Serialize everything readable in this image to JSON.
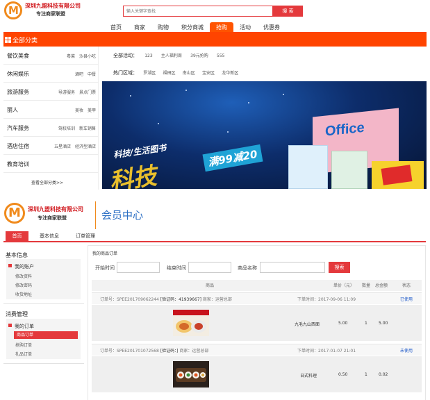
{
  "header": {
    "company_name": "深圳九盟科技有限公司",
    "slogan": "专注商家联盟",
    "search_placeholder": "输入关键字查找",
    "search_button": "搜 索",
    "nav": [
      "首页",
      "商家",
      "购物",
      "积分商城",
      "抢购",
      "活动",
      "优惠券"
    ],
    "nav_active": "抢购",
    "all_categories": "全部分类"
  },
  "categories": [
    {
      "name": "餐饮美食",
      "subs": [
        "粤菜",
        "沙县小吃"
      ]
    },
    {
      "name": "休闲娱乐",
      "subs": [
        "酒吧",
        "中餐"
      ]
    },
    {
      "name": "旅游服务",
      "subs": [
        "导游服务",
        "景点门票"
      ]
    },
    {
      "name": "丽人",
      "subs": [
        "美妆",
        "美甲"
      ]
    },
    {
      "name": "汽车服务",
      "subs": [
        "驾校培训",
        "新车销售"
      ]
    },
    {
      "name": "酒店住宿",
      "subs": [
        "五星酒店",
        "经济型酒店"
      ]
    },
    {
      "name": "教育培训",
      "subs": []
    }
  ],
  "view_all": "查看全部分类>>",
  "activities": {
    "label": "全部活动：",
    "items": [
      "123",
      "主人福利周",
      "39元抢购",
      "555"
    ]
  },
  "hot_areas": {
    "label": "热门区域：",
    "items": [
      "罗湖区",
      "福田区",
      "南山区",
      "宝安区",
      "龙华新区"
    ]
  },
  "banner": {
    "tag_line": "科技/生活图书",
    "promo": "满99减20",
    "big_text": "科技",
    "book_title": "Office"
  },
  "member": {
    "title": "会员中心",
    "tabs": [
      "首页",
      "基本信息",
      "订单管理"
    ],
    "active_tab": "首页"
  },
  "sidebar": {
    "basic_info": "基本信息",
    "my_account": "我的账户",
    "account_links": [
      "修改资料",
      "修改密码",
      "收货地址"
    ],
    "consume_mgmt": "消费管理",
    "my_orders": "我的订单",
    "order_links": [
      "商品订单",
      "抢购订单",
      "礼品订单"
    ],
    "active_link": "商品订单"
  },
  "orders": {
    "title": "我的商品订单",
    "filters": {
      "start_time": "开始时间",
      "end_time": "结束时间",
      "product_name": "商品名称",
      "search_button": "搜索"
    },
    "columns": [
      "商品",
      "单价（元）",
      "数量",
      "总金额",
      "状态"
    ],
    "rows": [
      {
        "order_no": "订单号：SPEE201709062244",
        "verify_label": "[验证码：",
        "verify_code": "41939667",
        "verify_end": "]",
        "merchant": "商家：运营总部",
        "order_time": "下单时间：2017-09-06 11:09",
        "product": "九毛九山西面",
        "price": "5.00",
        "qty": "1",
        "total": "5.00",
        "status": "已使用"
      },
      {
        "order_no": "订单号：SPEE201701072568",
        "verify_label": "[验证码：",
        "verify_code": "",
        "verify_end": "]",
        "merchant": "商家：运营总部",
        "order_time": "下单时间：2017-01-07 21:01",
        "product": "日式料理",
        "price": "0.50",
        "qty": "1",
        "total": "0.02",
        "status": "未使用"
      }
    ]
  },
  "colors": {
    "brand_red": "#e4393c",
    "nav_orange": "#ff5400",
    "logo_orange": "#f08a1c",
    "title_blue": "#2b6fc4"
  }
}
